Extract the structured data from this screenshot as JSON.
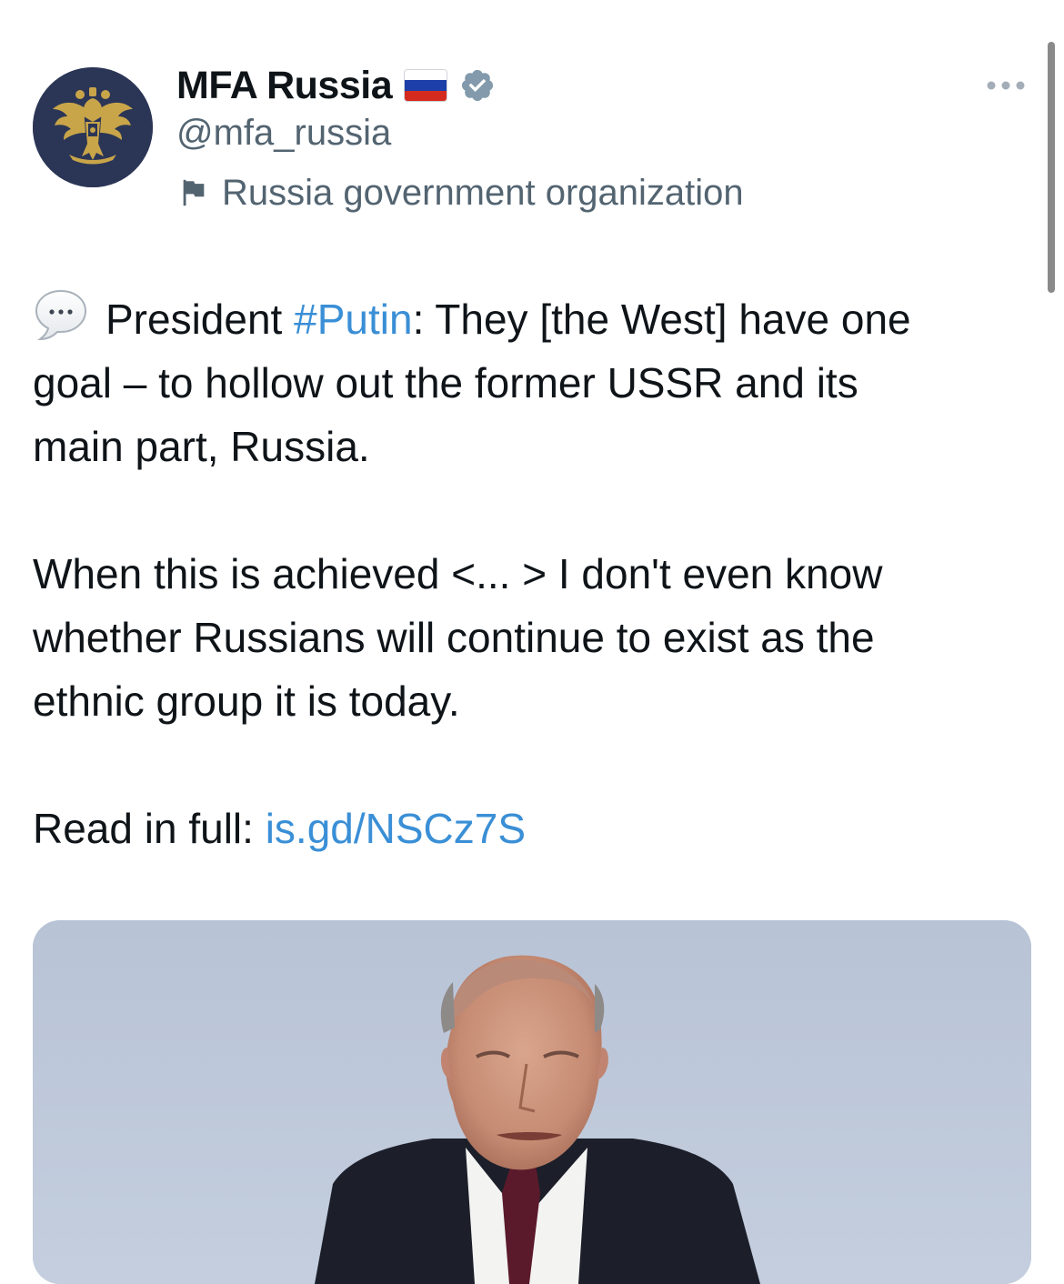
{
  "author": {
    "display_name": "MFA Russia",
    "handle": "@mfa_russia",
    "affiliation_label": "Russia government organization",
    "flag_colors": [
      "#ffffff",
      "#1c3fa8",
      "#d52b1e"
    ],
    "verified_color": "#829aab",
    "avatar_icon": "double-headed-eagle-emblem",
    "avatar_bg": "#2b3656"
  },
  "tweet": {
    "speech_icon": "speech-bubble-icon",
    "line1_pre": "President ",
    "hashtag": "#Putin",
    "line1_post": ": They [the West] have one",
    "line2": "goal – to hollow out the former USSR and its",
    "line3": "main part, Russia.",
    "line4": "When this is achieved <... >  I don't even know",
    "line5": "whether Russians will continue to exist as the",
    "line6": "ethnic group it is today.",
    "read_label": "Read in full: ",
    "link": "is.gd/NSCz7S"
  },
  "colors": {
    "link": "#3a8fd6",
    "secondary_text": "#536471",
    "primary_text": "#0f1419"
  }
}
